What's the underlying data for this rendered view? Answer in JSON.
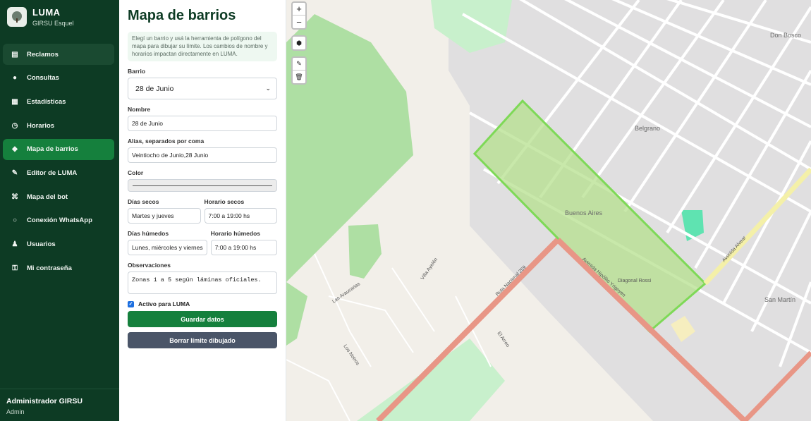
{
  "brand": {
    "name": "LUMA",
    "subtitle": "GIRSU Esquel",
    "logo_icon": "tree-logo-icon"
  },
  "sidebar": {
    "items": [
      {
        "label": "Reclamos",
        "icon": "inbox-icon",
        "state": "hover"
      },
      {
        "label": "Consultas",
        "icon": "chat-icon",
        "state": ""
      },
      {
        "label": "Estadísticas",
        "icon": "bar-chart-icon",
        "state": ""
      },
      {
        "label": "Horarios",
        "icon": "clock-icon",
        "state": ""
      },
      {
        "label": "Mapa de barrios",
        "icon": "map-pin-icon",
        "state": "active"
      },
      {
        "label": "Editor de LUMA",
        "icon": "pencil-icon",
        "state": ""
      },
      {
        "label": "Mapa del bot",
        "icon": "command-icon",
        "state": ""
      },
      {
        "label": "Conexión WhatsApp",
        "icon": "whatsapp-icon",
        "state": ""
      },
      {
        "label": "Usuarios",
        "icon": "user-icon",
        "state": ""
      },
      {
        "label": "Mi contraseña",
        "icon": "key-icon",
        "state": ""
      }
    ],
    "user_name": "Administrador GIRSU",
    "user_role": "Admin"
  },
  "panel": {
    "title": "Mapa de barrios",
    "hint": "Elegí un barrio y usá la herramienta de polígono del mapa para dibujar su límite. Los cambios de nombre y horarios impactan directamente en LUMA.",
    "barrio_label": "Barrio",
    "barrio_value": "28 de Junio",
    "nombre_label": "Nombre",
    "nombre_value": "28 de Junio",
    "alias_label": "Alias, separados por coma",
    "alias_value": "Veintiocho de Junio,28 Junio",
    "color_label": "Color",
    "color_value": "#ececec",
    "dias_secos_label": "Días secos",
    "dias_secos_value": "Martes y jueves",
    "horario_secos_label": "Horario secos",
    "horario_secos_value": "7:00 a 19:00 hs",
    "dias_humedos_label": "Días húmedos",
    "dias_humedos_value": "Lunes, miércoles y viernes",
    "horario_humedos_label": "Horario húmedos",
    "horario_humedos_value": "7:00 a 19:00 hs",
    "obs_label": "Observaciones",
    "obs_value": "Zonas 1 a 5 según láminas oficiales.",
    "activo_label": "Activo para LUMA",
    "activo_checked": true,
    "save_label": "Guardar datos",
    "clear_label": "Borrar límite dibujado"
  },
  "map": {
    "zoom_in": "+",
    "zoom_out": "−",
    "labels": {
      "don_bosco": "Don Bosco",
      "belgrano": "Belgrano",
      "buenos_aires": "Buenos Aires",
      "san_martin": "San Martín",
      "avenida_alvear": "Avenida Alvear",
      "ruta_259": "Ruta Nacional 259",
      "avenida_yrigoyen": "Avenida Hipólito Yrigoyen",
      "diagonal_rossi": "Diagonal Rossi",
      "villa_ayelen": "Villa Ayelén",
      "las_araucarias": "Las Araucarias",
      "el_arreo": "El Arreo",
      "los_notros": "Los Notros"
    },
    "colors": {
      "polygon": "#7ed957",
      "polygon_fill": "#b5e08e",
      "primary_road": "#e89686",
      "secondary_road": "#f4f0a8",
      "park": "#aedfa3"
    }
  }
}
